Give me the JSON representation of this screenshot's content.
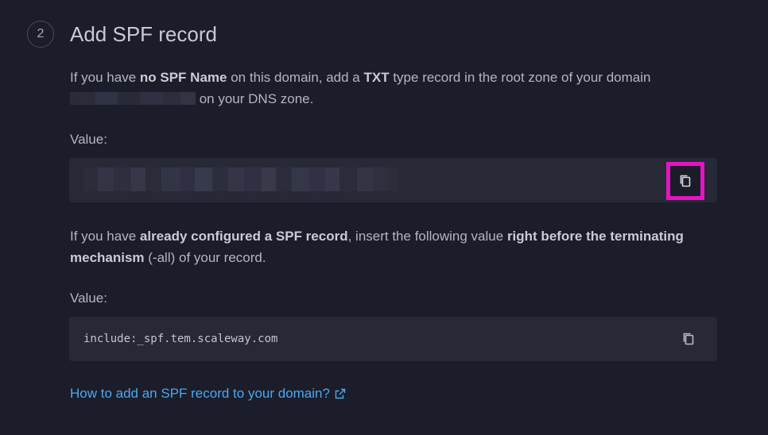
{
  "step": {
    "number": "2",
    "title": "Add SPF record"
  },
  "intro": {
    "part1": "If you have ",
    "bold1": "no SPF Name",
    "part2": " on this domain, add a ",
    "bold2": "TXT",
    "part3": " type record in the root zone of your domain ",
    "part4": " on your DNS zone."
  },
  "value_label_1": "Value:",
  "value_label_2": "Value:",
  "existing": {
    "part1": "If you have ",
    "bold1": "already configured a SPF record",
    "part2": ", insert the following value ",
    "bold2": "right before the terminating mechanism",
    "part3": " (-all) of your record."
  },
  "include_value": "include:_spf.tem.scaleway.com",
  "help_link": "How to add an SPF record to your domain?",
  "icons": {
    "copy": "copy-icon",
    "external": "external-link-icon"
  },
  "colors": {
    "background": "#1c1d2a",
    "box": "#272937",
    "link": "#4aa8f0",
    "highlight": "#e613c3"
  }
}
